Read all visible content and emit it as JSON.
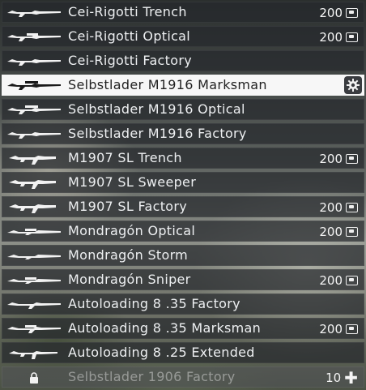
{
  "weapons": [
    {
      "name": "Cei-Rigotti Trench",
      "price": "200",
      "price_icon": "bond-icon"
    },
    {
      "name": "Cei-Rigotti Optical",
      "price": "200",
      "price_icon": "bond-icon"
    },
    {
      "name": "Cei-Rigotti Factory",
      "price": "",
      "price_icon": ""
    },
    {
      "name": "Selbstlader M1916 Marksman",
      "selected": true,
      "action_icon": "gear-icon"
    },
    {
      "name": "Selbstlader M1916 Optical",
      "price": "",
      "price_icon": ""
    },
    {
      "name": "Selbstlader M1916 Factory",
      "price": "",
      "price_icon": ""
    },
    {
      "name": "M1907 SL Trench",
      "price": "200",
      "price_icon": "bond-icon"
    },
    {
      "name": "M1907 SL Sweeper",
      "price": "",
      "price_icon": ""
    },
    {
      "name": "M1907 SL Factory",
      "price": "200",
      "price_icon": "bond-icon"
    },
    {
      "name": "Mondragón Optical",
      "price": "200",
      "price_icon": "bond-icon"
    },
    {
      "name": "Mondragón Storm",
      "price": "",
      "price_icon": ""
    },
    {
      "name": "Mondragón Sniper",
      "price": "200",
      "price_icon": "bond-icon"
    },
    {
      "name": "Autoloading 8 .35 Factory",
      "price": "",
      "price_icon": ""
    },
    {
      "name": "Autoloading 8 .35 Marksman",
      "price": "200",
      "price_icon": "bond-icon"
    },
    {
      "name": "Autoloading 8 .25 Extended",
      "price": "",
      "price_icon": ""
    },
    {
      "name": "Selbstlader 1906 Factory",
      "price": "10",
      "price_icon": "plus-icon",
      "locked": true,
      "status_icon": "lock-icon"
    }
  ],
  "colors": {
    "row_bg": "#26282c",
    "selected_bg": "#f7f7f7",
    "text": "#eef0f2"
  }
}
